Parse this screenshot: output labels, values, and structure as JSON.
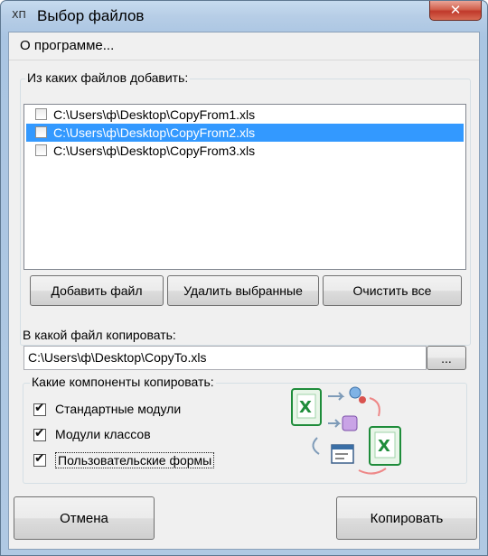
{
  "window": {
    "title": "Выбор файлов",
    "close_glyph": "✕",
    "app_icon": "ХП"
  },
  "menu": {
    "about": "О программе..."
  },
  "files_group": {
    "label": "Из каких файлов добавить:",
    "items": [
      {
        "path": "C:\\Users\\ф\\Desktop\\CopyFrom1.xls",
        "checked": false,
        "selected": false
      },
      {
        "path": "C:\\Users\\ф\\Desktop\\CopyFrom2.xls",
        "checked": false,
        "selected": true
      },
      {
        "path": "C:\\Users\\ф\\Desktop\\CopyFrom3.xls",
        "checked": false,
        "selected": false
      }
    ],
    "add_button": "Добавить файл",
    "remove_button": "Удалить выбранные",
    "clear_button": "Очистить все"
  },
  "target": {
    "label": "В какой файл копировать:",
    "value": "C:\\Users\\ф\\Desktop\\CopyTo.xls",
    "browse_button": "..."
  },
  "components_group": {
    "label": "Какие компоненты копировать:",
    "options": [
      {
        "label": "Стандартные модули",
        "checked": true
      },
      {
        "label": "Модули классов",
        "checked": true
      },
      {
        "label": "Пользовательские формы",
        "checked": true
      }
    ],
    "illustration_icon": "excel-copy-illustration-icon"
  },
  "footer": {
    "cancel_button": "Отмена",
    "copy_button": "Копировать"
  },
  "colors": {
    "selection": "#3399ff",
    "excel_green": "#1e8c3a",
    "close_red": "#c0392b"
  }
}
